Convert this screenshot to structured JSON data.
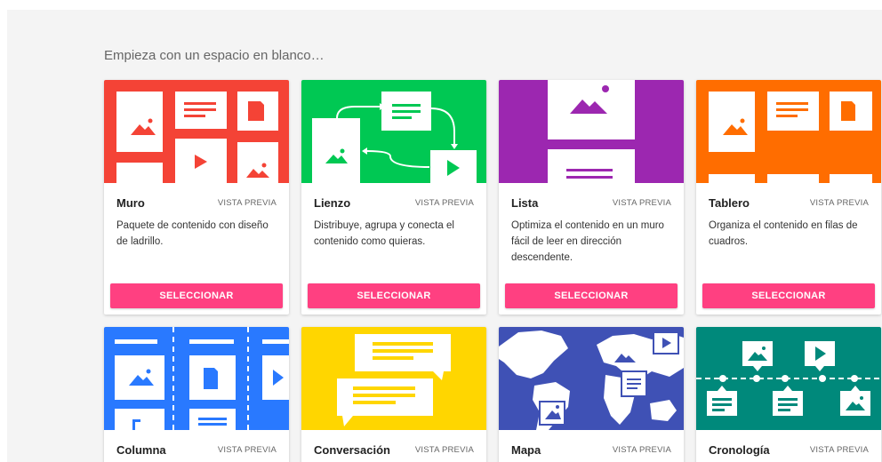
{
  "section": {
    "heading": "Empieza con un espacio en blanco…"
  },
  "cards": [
    {
      "title": "Muro",
      "preview": "VISTA PREVIA",
      "description": "Paquete de contenido con diseño de ladrillo.",
      "button": "SELECCIONAR",
      "color": "#f44336"
    },
    {
      "title": "Lienzo",
      "preview": "VISTA PREVIA",
      "description": "Distribuye, agrupa y conecta el contenido como quieras.",
      "button": "SELECCIONAR",
      "color": "#00c853"
    },
    {
      "title": "Lista",
      "preview": "VISTA PREVIA",
      "description": "Optimiza el contenido en un muro fácil de leer en dirección descendente.",
      "button": "SELECCIONAR",
      "color": "#9c27b0"
    },
    {
      "title": "Tablero",
      "preview": "VISTA PREVIA",
      "description": "Organiza el contenido en filas de cuadros.",
      "button": "SELECCIONAR",
      "color": "#ff6d00"
    },
    {
      "title": "Columna",
      "preview": "VISTA PREVIA",
      "color": "#2979ff"
    },
    {
      "title": "Conversación",
      "preview": "VISTA PREVIA",
      "color": "#ffd600"
    },
    {
      "title": "Mapa",
      "preview": "VISTA PREVIA",
      "color": "#3f51b5"
    },
    {
      "title": "Cronología",
      "preview": "VISTA PREVIA",
      "color": "#00897b"
    }
  ]
}
